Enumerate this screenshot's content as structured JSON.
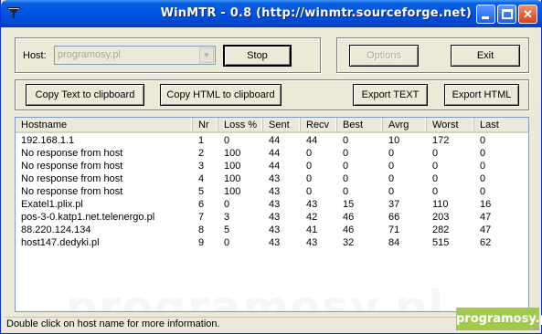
{
  "window": {
    "title": "WinMTR - 0.8 (http://winmtr.sourceforge.net)",
    "minimize_glyph": "_",
    "close_glyph": "✕"
  },
  "host": {
    "label": "Host:",
    "value": "programosy.pl"
  },
  "buttons": {
    "stop": "Stop",
    "options": "Options",
    "exit": "Exit",
    "copy_text": "Copy Text to clipboard",
    "copy_html": "Copy HTML to clipboard",
    "export_text": "Export TEXT",
    "export_html": "Export HTML"
  },
  "table": {
    "columns": [
      "Hostname",
      "Nr",
      "Loss %",
      "Sent",
      "Recv",
      "Best",
      "Avrg",
      "Worst",
      "Last"
    ],
    "rows": [
      [
        "192.168.1.1",
        "1",
        "0",
        "44",
        "44",
        "0",
        "10",
        "172",
        "0"
      ],
      [
        "No response from host",
        "2",
        "100",
        "44",
        "0",
        "0",
        "0",
        "0",
        "0"
      ],
      [
        "No response from host",
        "3",
        "100",
        "44",
        "0",
        "0",
        "0",
        "0",
        "0"
      ],
      [
        "No response from host",
        "4",
        "100",
        "43",
        "0",
        "0",
        "0",
        "0",
        "0"
      ],
      [
        "No response from host",
        "5",
        "100",
        "43",
        "0",
        "0",
        "0",
        "0",
        "0"
      ],
      [
        "Exatel1.plix.pl",
        "6",
        "0",
        "43",
        "43",
        "15",
        "37",
        "110",
        "16"
      ],
      [
        "pos-3-0.katp1.net.telenergo.pl",
        "7",
        "3",
        "43",
        "42",
        "46",
        "66",
        "203",
        "47"
      ],
      [
        "88.220.124.134",
        "8",
        "5",
        "43",
        "41",
        "46",
        "71",
        "282",
        "47"
      ],
      [
        "host147.dedyki.pl",
        "9",
        "0",
        "43",
        "43",
        "32",
        "84",
        "515",
        "62"
      ]
    ]
  },
  "watermark": "programosy.pl",
  "status_text": "Double click on host name for more information.",
  "brand_badge": "programosy.pl",
  "colors": {
    "titlebar": "#0054e3",
    "window_bg": "#ece9d8",
    "badge": "#9fca4c"
  },
  "icons": [
    "winmtr-app-icon",
    "minimize-icon",
    "maximize-icon",
    "close-icon",
    "chevron-down-icon",
    "size-grip-icon"
  ]
}
